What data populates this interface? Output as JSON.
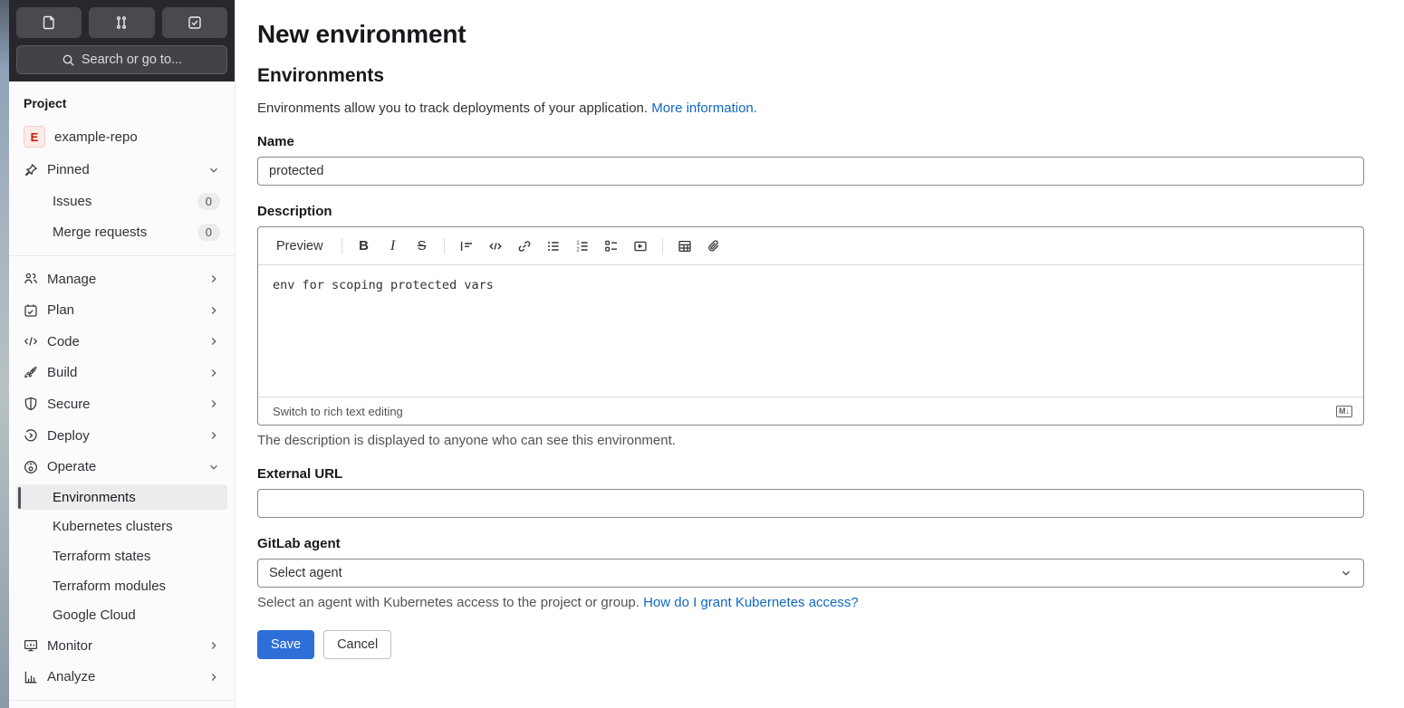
{
  "topbar": {
    "search_label": "Search or go to...",
    "shortcuts": [
      {
        "name": "issues"
      },
      {
        "name": "merge-requests"
      },
      {
        "name": "todo-list"
      }
    ]
  },
  "sidebar": {
    "section_label": "Project",
    "project": {
      "avatar_letter": "E",
      "name": "example-repo"
    },
    "pinned_label": "Pinned",
    "pinned_items": [
      {
        "label": "Issues",
        "badge": "0"
      },
      {
        "label": "Merge requests",
        "badge": "0"
      }
    ],
    "nav": [
      {
        "label": "Manage"
      },
      {
        "label": "Plan"
      },
      {
        "label": "Code"
      },
      {
        "label": "Build"
      },
      {
        "label": "Secure"
      },
      {
        "label": "Deploy"
      },
      {
        "label": "Operate"
      }
    ],
    "operate_children": [
      "Environments",
      "Kubernetes clusters",
      "Terraform states",
      "Terraform modules",
      "Google Cloud"
    ],
    "selected_item": "Environments",
    "nav_bottom": [
      {
        "label": "Monitor"
      },
      {
        "label": "Analyze"
      }
    ]
  },
  "main": {
    "page_title": "New environment",
    "section_title": "Environments",
    "intro_text": "Environments allow you to track deployments of your application.",
    "intro_link": "More information.",
    "name_label": "Name",
    "name_value": "protected",
    "description_label": "Description",
    "editor": {
      "preview_tab": "Preview",
      "content": "env for scoping protected vars",
      "switch_link": "Switch to rich text editing",
      "markdown_badge": "M↓"
    },
    "description_help": "The description is displayed to anyone who can see this environment.",
    "external_url_label": "External URL",
    "external_url_value": "",
    "agent_label": "GitLab agent",
    "agent_value": "Select agent",
    "agent_help": "Select an agent with Kubernetes access to the project or group.",
    "agent_help_link": "How do I grant Kubernetes access?",
    "save_label": "Save",
    "cancel_label": "Cancel"
  },
  "colors": {
    "accent_blue": "#2d6ed9",
    "link_blue": "#1068bf",
    "header_dark": "#28272d",
    "sidebar_bg": "#fbfafd",
    "selected_bg": "#ececef"
  }
}
